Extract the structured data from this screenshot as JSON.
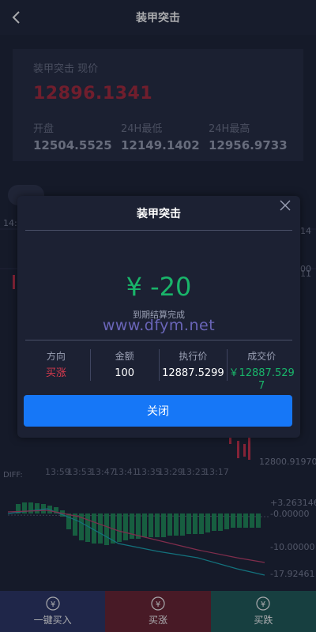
{
  "header": {
    "title": "装甲突击"
  },
  "price_card": {
    "label": "装甲突击 现价",
    "price": "12896.1341",
    "stats": [
      {
        "label": "开盘",
        "value": "12504.5525"
      },
      {
        "label": "24H最低",
        "value": "12149.1402"
      },
      {
        "label": "24H最高",
        "value": "12956.9733"
      }
    ]
  },
  "chart": {
    "axis_left": "14:",
    "axis_right_top": "14",
    "axis_right_mid1": "00",
    "axis_right_mid2": "11",
    "price_low": "12800.91970",
    "diff_label": "DIFF:",
    "times": [
      "13:59",
      "13:53",
      "13:47",
      "13:41",
      "13:35",
      "13:29",
      "13:23",
      "13:17"
    ],
    "macd_labels": [
      "+3.263146",
      "-0.00000",
      "-10.00000",
      "-17.92461"
    ]
  },
  "modal": {
    "title": "装甲突击",
    "amount": "¥ -20",
    "status": "到期结算完成",
    "watermark": "www.dfym.net",
    "columns": [
      {
        "head": "方向",
        "value": "买涨"
      },
      {
        "head": "金额",
        "value": "100"
      },
      {
        "head": "执行价",
        "value": "12887.5299"
      },
      {
        "head": "成交价",
        "value": "￥12887.5297"
      }
    ],
    "close_label": "关闭"
  },
  "bottom": {
    "buttons": [
      {
        "label": "一键买入",
        "color": "#2c3566"
      },
      {
        "label": "买涨",
        "color": "#6b2231"
      },
      {
        "label": "买跌",
        "color": "#1f5b58"
      }
    ]
  },
  "colors": {
    "accent": "#1677f7",
    "up": "#d83a4e",
    "down": "#19b56a"
  }
}
